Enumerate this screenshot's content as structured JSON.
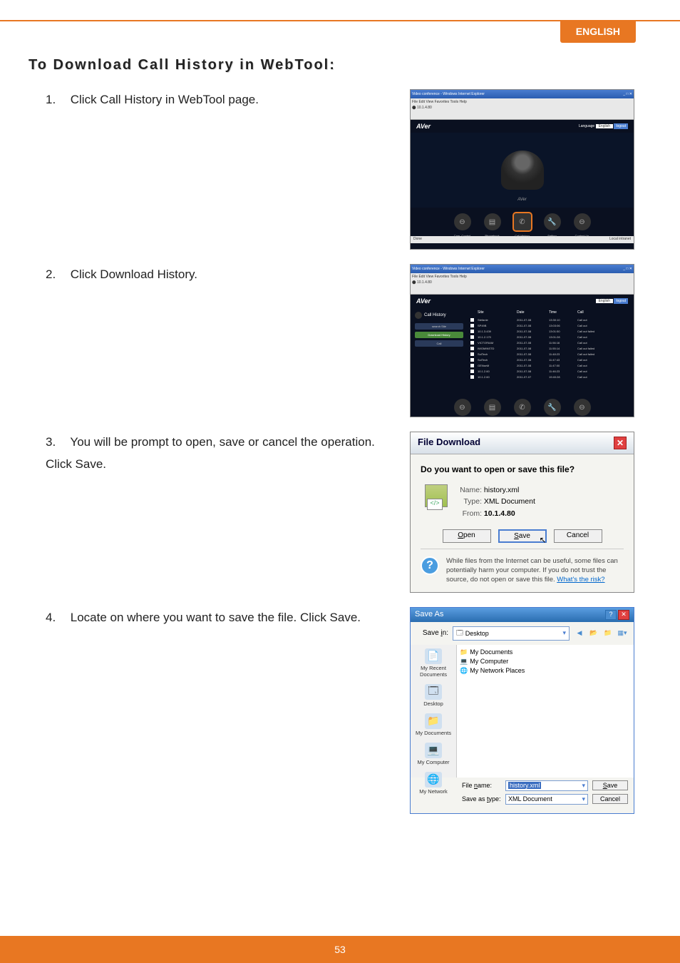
{
  "language_tab": "ENGLISH",
  "section_title": "To Download Call History in WebTool:",
  "steps": {
    "s1": {
      "num": "1.",
      "text": "Click Call History in WebTool page."
    },
    "s2": {
      "num": "2.",
      "text": "Click Download History."
    },
    "s3": {
      "num": "3.",
      "text": "You will be prompt to open, save or cancel the operation. Click Save."
    },
    "s4": {
      "num": "4.",
      "text": "Locate on where you want to save the file. Click Save."
    }
  },
  "screenshot1": {
    "window_title": "Video conference - Windows Internet Explorer",
    "brand": "AVer",
    "camera_label": "AVer",
    "lang_label": "Language",
    "lang_value": "English",
    "logout": "logout",
    "nav": {
      "cam": "Cam. Control",
      "phonebook": "Phonebook",
      "callhistory": "Call History",
      "setting": "Setting",
      "contact": "Contact Us"
    },
    "status_right": "Local intranet"
  },
  "screenshot2": {
    "title": "Call History",
    "buttons": {
      "search": "search Site",
      "download": "Download History",
      "call": "Call"
    },
    "headers": {
      "site": "Site",
      "date": "Date",
      "time": "Time",
      "call": "Call"
    },
    "rows": [
      {
        "site": "Stefanie",
        "date": "2011-07-08",
        "time": "13:30:10",
        "call": "Call out"
      },
      {
        "site": "SP49B",
        "date": "2011-07-08",
        "time": "13:03:06",
        "call": "Call out"
      },
      {
        "site": "10.1.3.439",
        "date": "2011-07-08",
        "time": "13:01:50",
        "call": "Call out failed"
      },
      {
        "site": "10.1.2.170",
        "date": "2011-07-08",
        "time": "13:01:28",
        "call": "Call out"
      },
      {
        "site": "VICTORIAM",
        "date": "2011-07-08",
        "time": "11:56:16",
        "call": "Call out"
      },
      {
        "site": "IWOMINSTD",
        "date": "2011-07-08",
        "time": "11:55:14",
        "call": "Call out failed"
      },
      {
        "site": "SolTech",
        "date": "2011-07-08",
        "time": "11:48:23",
        "call": "Call out failed"
      },
      {
        "site": "SolTech",
        "date": "2011-07-08",
        "time": "11:47:43",
        "call": "Call out"
      },
      {
        "site": "GENseM",
        "date": "2011-07-08",
        "time": "11:47:00",
        "call": "Call out"
      },
      {
        "site": "10.1.2.60",
        "date": "2011-07-08",
        "time": "11:46:23",
        "call": "Call out"
      },
      {
        "site": "10.1.2.60",
        "date": "2011-07-07",
        "time": "19:40:28",
        "call": "Call out"
      }
    ]
  },
  "screenshot3": {
    "title": "File Download",
    "question": "Do you want to open or save this file?",
    "name_label": "Name:",
    "name_value": "history.xml",
    "type_label": "Type:",
    "type_value": "XML Document",
    "from_label": "From:",
    "from_value": "10.1.4.80",
    "buttons": {
      "open": "Open",
      "save": "Save",
      "cancel": "Cancel"
    },
    "warning": "While files from the Internet can be useful, some files can potentially harm your computer. If you do not trust the source, do not open or save this file.",
    "warning_link": "What's the risk?"
  },
  "screenshot4": {
    "title": "Save As",
    "savein_label": "Save in:",
    "savein_value": "Desktop",
    "folders": {
      "mydocs": "My Documents",
      "mycomp": "My Computer",
      "mynet": "My Network Places"
    },
    "sidebar": {
      "recent": "My Recent Documents",
      "desktop": "Desktop",
      "mydocs": "My Documents",
      "mycomp": "My Computer",
      "mynet": "My Network"
    },
    "filename_label": "File name:",
    "filename_value": "history.xml",
    "savetype_label": "Save as type:",
    "savetype_value": "XML Document",
    "buttons": {
      "save": "Save",
      "cancel": "Cancel"
    }
  },
  "page_number": "53"
}
